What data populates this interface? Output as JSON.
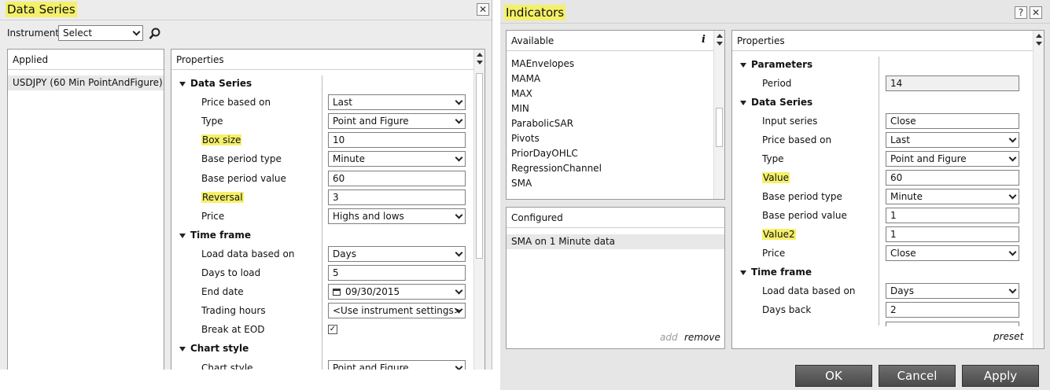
{
  "data_series_window": {
    "title": "Data Series",
    "instrument_label": "Instrument",
    "instrument_select": "Select",
    "applied_header": "Applied",
    "applied_item": "USDJPY (60 Min PointAndFigure)",
    "properties_header": "Properties",
    "categories": [
      "Data Series",
      "Time frame",
      "Chart style"
    ],
    "rows": [
      {
        "label": "Price based on",
        "value": "Last",
        "kind": "select"
      },
      {
        "label": "Type",
        "value": "Point and Figure",
        "kind": "select"
      },
      {
        "label": "Box size",
        "value": "10",
        "kind": "text",
        "highlight": true
      },
      {
        "label": "Base period type",
        "value": "Minute",
        "kind": "select"
      },
      {
        "label": "Base period value",
        "value": "60",
        "kind": "text"
      },
      {
        "label": "Reversal",
        "value": "3",
        "kind": "text",
        "highlight": true
      },
      {
        "label": "Price",
        "value": "Highs and lows",
        "kind": "select"
      },
      {
        "label": "Load data based on",
        "value": "Days",
        "kind": "select"
      },
      {
        "label": "Days to load",
        "value": "5",
        "kind": "text"
      },
      {
        "label": "End date",
        "value": "09/30/2015",
        "kind": "date"
      },
      {
        "label": "Trading hours",
        "value": "<Use instrument settings>",
        "kind": "select"
      },
      {
        "label": "Break at EOD",
        "value": "✓",
        "kind": "check"
      },
      {
        "label": "Chart style",
        "value": "Point and Figure",
        "kind": "select"
      }
    ],
    "close_glyph": "✕"
  },
  "indicators_window": {
    "title": "Indicators",
    "help_glyph": "?",
    "close_glyph": "✕",
    "available_header": "Available",
    "info_glyph": "i",
    "available_items": [
      "MAEnvelopes",
      "MAMA",
      "MAX",
      "MIN",
      "ParabolicSAR",
      "Pivots",
      "PriorDayOHLC",
      "RegressionChannel",
      "SMA"
    ],
    "configured_header": "Configured",
    "configured_item": "SMA on 1 Minute data",
    "add_link": "add",
    "remove_link": "remove",
    "properties_header": "Properties",
    "categories": [
      "Parameters",
      "Data Series",
      "Time frame"
    ],
    "rows": [
      {
        "label": "Period",
        "value": "14",
        "kind": "readonly"
      },
      {
        "label": "Input series",
        "value": "Close",
        "kind": "text"
      },
      {
        "label": "Price based on",
        "value": "Last",
        "kind": "select"
      },
      {
        "label": "Type",
        "value": "Point and Figure",
        "kind": "select"
      },
      {
        "label": "Value",
        "value": "60",
        "kind": "text",
        "highlight": true
      },
      {
        "label": "Base period type",
        "value": "Minute",
        "kind": "select"
      },
      {
        "label": "Base period value",
        "value": "1",
        "kind": "text"
      },
      {
        "label": "Value2",
        "value": "1",
        "kind": "text",
        "highlight": true
      },
      {
        "label": "Price",
        "value": "Close",
        "kind": "select"
      },
      {
        "label": "Load data based on",
        "value": "Days",
        "kind": "select"
      },
      {
        "label": "Days back",
        "value": "2",
        "kind": "text"
      }
    ],
    "preset_link": "preset",
    "buttons": {
      "ok": "OK",
      "cancel": "Cancel",
      "apply": "Apply"
    }
  },
  "colors": {
    "highlight": "#f5f06a",
    "button": "#5a5a5a"
  }
}
